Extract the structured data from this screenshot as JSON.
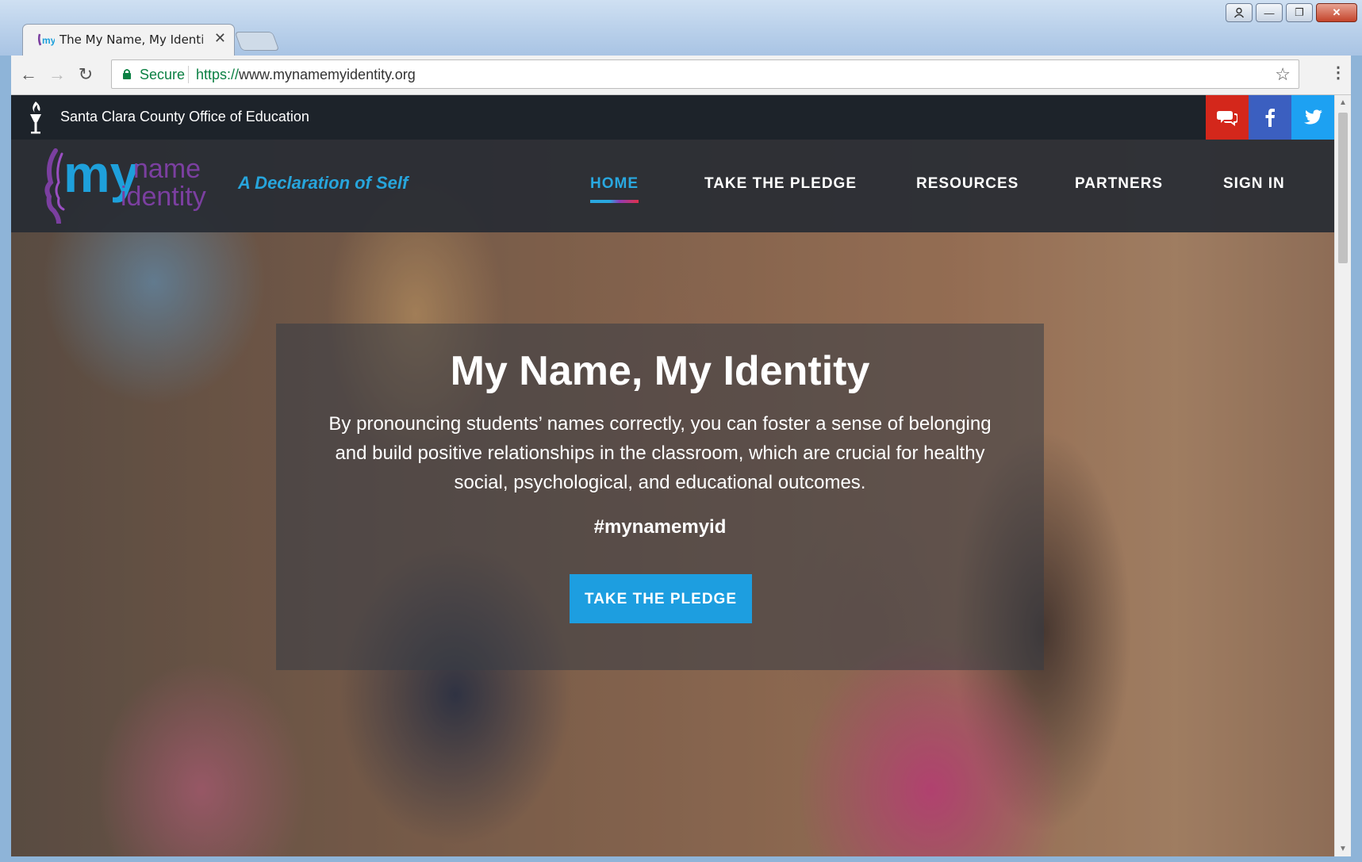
{
  "browser": {
    "tab_title": "The My Name, My Identi",
    "tab_close": "✕",
    "secure_label": "Secure",
    "url_scheme": "https://",
    "url_rest": "www.mynamemyidentity.org",
    "star_icon": "☆",
    "menu_icon": "⋮",
    "back_icon": "←",
    "forward_icon": "→",
    "reload_icon": "↻",
    "minimize_icon": "—",
    "maximize_icon": "❐",
    "close_icon": "✕",
    "user_icon": "👤"
  },
  "utility": {
    "org_name": "Santa Clara County Office of Education",
    "social": [
      {
        "name": "chat-icon",
        "color": "#d4271b"
      },
      {
        "name": "facebook-icon",
        "color": "#3b5fc0"
      },
      {
        "name": "twitter-icon",
        "color": "#1da1f2"
      }
    ]
  },
  "header": {
    "logo_my": "my",
    "logo_name": "name",
    "logo_identity": "identity",
    "tagline": "A Declaration of Self",
    "nav": [
      {
        "label": "HOME",
        "active": true
      },
      {
        "label": "TAKE THE PLEDGE",
        "active": false
      },
      {
        "label": "RESOURCES",
        "active": false
      },
      {
        "label": "PARTNERS",
        "active": false
      },
      {
        "label": "SIGN IN",
        "active": false
      }
    ]
  },
  "hero": {
    "title": "My Name, My Identity",
    "body": "By pronouncing students’ names correctly, you can foster a sense of belonging and build positive relationships in the classroom, which are crucial for healthy social, psychological, and educational outcomes.",
    "hashtag": "#mynamemyid",
    "cta_label": "TAKE THE PLEDGE"
  },
  "colors": {
    "accent": "#29a8e0",
    "logo_purple": "#7b3fa0",
    "logo_blue": "#1ea0db",
    "secure_green": "#0b8043"
  }
}
